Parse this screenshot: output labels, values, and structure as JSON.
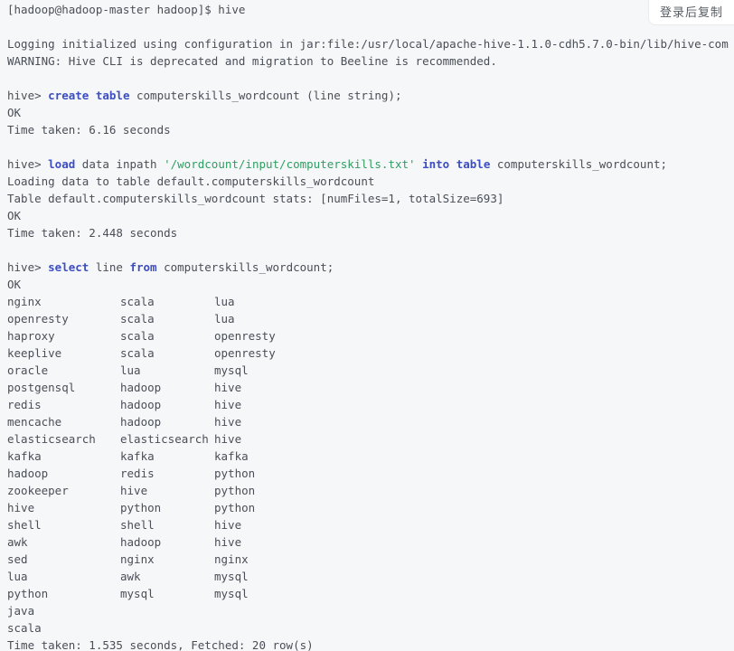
{
  "copy_button": {
    "label": "登录后复制"
  },
  "colors": {
    "background": "#f6f7f8",
    "text": "#4a4e57",
    "keyword": "#3c4ec2",
    "string": "#2f9e62",
    "button_bg": "#ffffff",
    "button_text": "#575c63",
    "button_border": "#e9ebee"
  },
  "terminal": {
    "lines": [
      {
        "seg": [
          {
            "t": "[hadoop@hadoop-master hadoop]$ hive"
          }
        ]
      },
      {
        "seg": []
      },
      {
        "seg": [
          {
            "t": "Logging initialized using configuration in jar:file:/usr/local/apache-hive-1.1.0-cdh5.7.0-bin/lib/hive-com"
          }
        ]
      },
      {
        "seg": [
          {
            "t": "WARNING: Hive CLI is deprecated and migration to Beeline is recommended."
          }
        ]
      },
      {
        "seg": []
      },
      {
        "seg": [
          {
            "t": "hive> "
          },
          {
            "t": "create table",
            "c": "kw"
          },
          {
            "t": " computerskills_wordcount (line string);"
          }
        ]
      },
      {
        "seg": [
          {
            "t": "OK"
          }
        ]
      },
      {
        "seg": [
          {
            "t": "Time taken: 6.16 seconds"
          }
        ]
      },
      {
        "seg": []
      },
      {
        "seg": [
          {
            "t": "hive> "
          },
          {
            "t": "load",
            "c": "kw"
          },
          {
            "t": " data inpath "
          },
          {
            "t": "'/wordcount/input/computerskills.txt'",
            "c": "str"
          },
          {
            "t": " "
          },
          {
            "t": "into table",
            "c": "kw"
          },
          {
            "t": " computerskills_wordcount;"
          }
        ]
      },
      {
        "seg": [
          {
            "t": "Loading data to table default.computerskills_wordcount"
          }
        ]
      },
      {
        "seg": [
          {
            "t": "Table default.computerskills_wordcount stats: [numFiles=1, totalSize=693]"
          }
        ]
      },
      {
        "seg": [
          {
            "t": "OK"
          }
        ]
      },
      {
        "seg": [
          {
            "t": "Time taken: 2.448 seconds"
          }
        ]
      },
      {
        "seg": []
      },
      {
        "seg": [
          {
            "t": "hive> "
          },
          {
            "t": "select",
            "c": "kw"
          },
          {
            "t": " line "
          },
          {
            "t": "from",
            "c": "kw"
          },
          {
            "t": " computerskills_wordcount;"
          }
        ]
      },
      {
        "seg": [
          {
            "t": "OK"
          }
        ]
      },
      {
        "cells": [
          "nginx",
          "scala",
          "lua"
        ]
      },
      {
        "cells": [
          "openresty",
          "scala",
          "lua"
        ]
      },
      {
        "cells": [
          "haproxy",
          "scala",
          "openresty"
        ]
      },
      {
        "cells": [
          "keeplive",
          "scala",
          "openresty"
        ]
      },
      {
        "cells": [
          "oracle",
          "lua",
          "mysql"
        ]
      },
      {
        "cells": [
          "postgensql",
          "hadoop",
          "hive"
        ]
      },
      {
        "cells": [
          "redis",
          "hadoop",
          "hive"
        ]
      },
      {
        "cells": [
          "mencache",
          "hadoop",
          "hive"
        ]
      },
      {
        "cells": [
          "elasticsearch",
          "elasticsearch",
          "hive"
        ]
      },
      {
        "cells": [
          "kafka",
          "kafka",
          "kafka"
        ]
      },
      {
        "cells": [
          "hadoop",
          "redis",
          "python"
        ]
      },
      {
        "cells": [
          "zookeeper",
          "hive",
          "python"
        ]
      },
      {
        "cells": [
          "hive",
          "python",
          "python"
        ]
      },
      {
        "cells": [
          "shell",
          "shell",
          "hive"
        ]
      },
      {
        "cells": [
          "awk",
          "hadoop",
          "hive"
        ]
      },
      {
        "cells": [
          "sed",
          "nginx",
          "nginx"
        ]
      },
      {
        "cells": [
          "lua",
          "awk",
          "mysql"
        ]
      },
      {
        "cells": [
          "python",
          "mysql",
          "mysql"
        ]
      },
      {
        "cells": [
          "java"
        ]
      },
      {
        "cells": [
          "scala"
        ]
      },
      {
        "seg": [
          {
            "t": "Time taken: 1.535 seconds, Fetched: 20 row(s)"
          }
        ]
      }
    ]
  }
}
